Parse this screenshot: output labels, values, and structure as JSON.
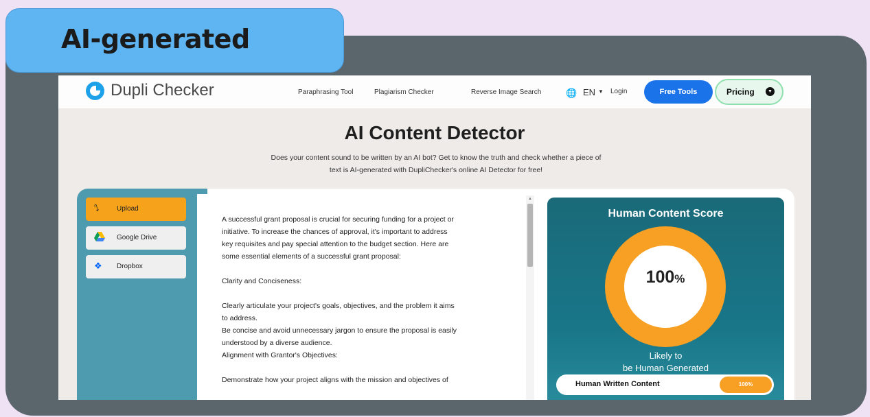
{
  "badge": {
    "label": "AI-generated"
  },
  "nav": {
    "logo": "Dupli Checker",
    "links": [
      "Paraphrasing Tool",
      "Plagiarism Checker",
      "Reverse Image Search"
    ],
    "language": "EN",
    "login": "Login",
    "free_tools": "Free Tools",
    "pricing": "Pricing"
  },
  "hero": {
    "title": "AI Content Detector",
    "subtitle_line1": "Does your content sound to be written by an AI bot? Get to know the truth and check whether a piece of",
    "subtitle_line2": "text is AI-generated with DupliChecker's online AI Detector for free!"
  },
  "sources": {
    "upload": "Upload",
    "google_drive": "Google Drive",
    "dropbox": "Dropbox"
  },
  "editor": {
    "lines": [
      "A successful grant proposal is crucial for securing funding for a project or",
      "initiative. To increase the chances of approval, it's important to address",
      "key requisites and pay special attention to the budget section. Here are",
      "some essential elements of a successful grant proposal:",
      "",
      "Clarity and Conciseness:",
      "",
      "Clearly articulate your project's goals, objectives, and the problem it aims",
      "to address.",
      "Be concise and avoid unnecessary jargon to ensure the proposal is easily",
      "understood by a diverse audience.",
      "Alignment with Grantor's Objectives:",
      "",
      "Demonstrate how your project aligns with the mission and objectives of"
    ]
  },
  "score": {
    "title": "Human Content Score",
    "value": "100",
    "unit": "%",
    "likely_line1": "Likely to",
    "likely_line2": "be Human Generated",
    "bar_label": "Human Written Content",
    "bar_value": "100%",
    "percent": 100
  },
  "colors": {
    "accent_blue": "#1a73e8",
    "accent_orange": "#f8a024",
    "panel_teal": "#187688"
  }
}
